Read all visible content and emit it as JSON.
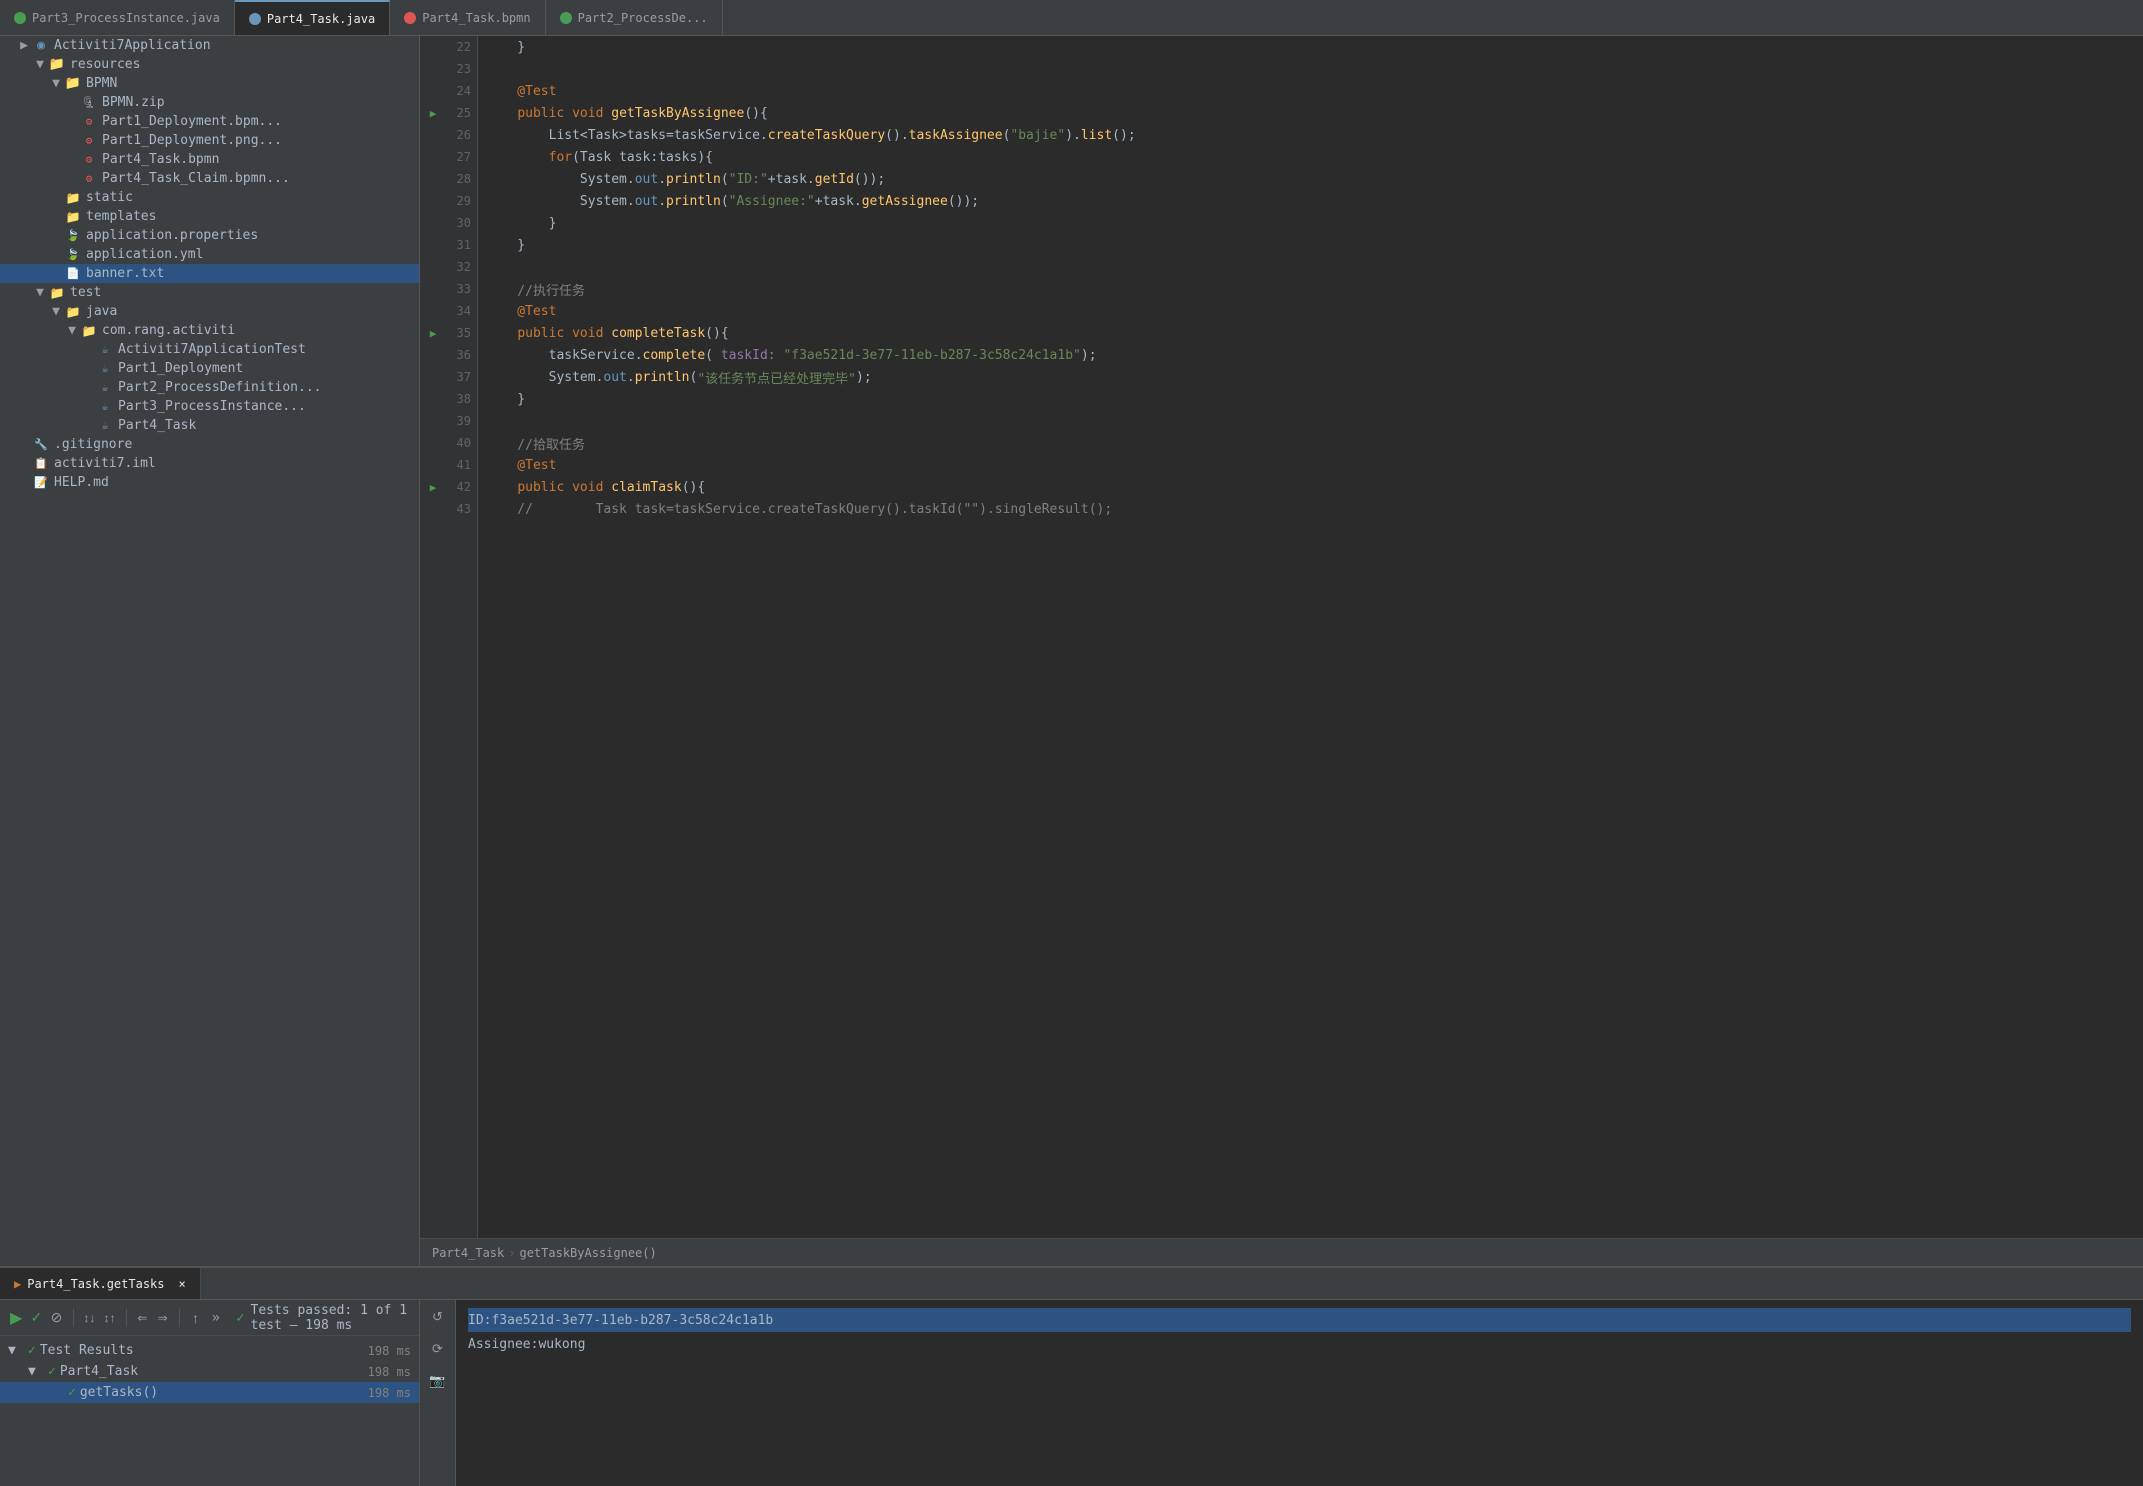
{
  "tabs": [
    {
      "label": "Part3_ProcessInstance.java",
      "status": "green",
      "active": false
    },
    {
      "label": "Part4_Task.java",
      "status": "blue",
      "active": true
    },
    {
      "label": "Part4_Task.bpmn",
      "status": "red",
      "active": false
    },
    {
      "label": "Part2_ProcessDe...",
      "status": "green",
      "active": false
    }
  ],
  "sidebar": {
    "tree": [
      {
        "indent": 0,
        "arrow": "▶",
        "icon": "app",
        "label": "Activiti7Application",
        "type": "app"
      },
      {
        "indent": 1,
        "arrow": "▼",
        "icon": "folder",
        "label": "resources",
        "type": "folder"
      },
      {
        "indent": 2,
        "arrow": "▼",
        "icon": "folder",
        "label": "BPMN",
        "type": "folder"
      },
      {
        "indent": 3,
        "arrow": "",
        "icon": "zip",
        "label": "BPMN.zip",
        "type": "zip"
      },
      {
        "indent": 3,
        "arrow": "",
        "icon": "bpmn",
        "label": "Part1_Deployment.bpm...",
        "type": "bpmn"
      },
      {
        "indent": 3,
        "arrow": "",
        "icon": "bpmn",
        "label": "Part1_Deployment.png...",
        "type": "bpmn"
      },
      {
        "indent": 3,
        "arrow": "",
        "icon": "bpmn",
        "label": "Part4_Task.bpmn",
        "type": "bpmn"
      },
      {
        "indent": 3,
        "arrow": "",
        "icon": "bpmn",
        "label": "Part4_Task_Claim.bpmn...",
        "type": "bpmn"
      },
      {
        "indent": 2,
        "arrow": "",
        "icon": "folder",
        "label": "static",
        "type": "folder"
      },
      {
        "indent": 2,
        "arrow": "",
        "icon": "folder",
        "label": "templates",
        "type": "folder"
      },
      {
        "indent": 2,
        "arrow": "",
        "icon": "spring",
        "label": "application.properties",
        "type": "spring"
      },
      {
        "indent": 2,
        "arrow": "",
        "icon": "spring",
        "label": "application.yml",
        "type": "spring"
      },
      {
        "indent": 2,
        "arrow": "",
        "icon": "txt",
        "label": "banner.txt",
        "type": "txt",
        "selected": true
      },
      {
        "indent": 1,
        "arrow": "▼",
        "icon": "folder",
        "label": "test",
        "type": "folder"
      },
      {
        "indent": 2,
        "arrow": "▼",
        "icon": "folder",
        "label": "java",
        "type": "folder"
      },
      {
        "indent": 3,
        "arrow": "▼",
        "icon": "folder",
        "label": "com.rang.activiti",
        "type": "folder"
      },
      {
        "indent": 4,
        "arrow": "",
        "icon": "java",
        "label": "Activiti7ApplicationTest",
        "type": "java"
      },
      {
        "indent": 4,
        "arrow": "",
        "icon": "java",
        "label": "Part1_Deployment",
        "type": "java"
      },
      {
        "indent": 4,
        "arrow": "",
        "icon": "java",
        "label": "Part2_ProcessDefinition...",
        "type": "java"
      },
      {
        "indent": 4,
        "arrow": "",
        "icon": "java",
        "label": "Part3_ProcessInstance...",
        "type": "java"
      },
      {
        "indent": 4,
        "arrow": "",
        "icon": "java",
        "label": "Part4_Task",
        "type": "java"
      },
      {
        "indent": 0,
        "arrow": "",
        "icon": "git",
        "label": ".gitignore",
        "type": "git"
      },
      {
        "indent": 0,
        "arrow": "",
        "icon": "iml",
        "label": "activiti7.iml",
        "type": "iml"
      },
      {
        "indent": 0,
        "arrow": "",
        "icon": "md",
        "label": "HELP.md",
        "type": "md"
      }
    ]
  },
  "code": {
    "lines": [
      {
        "num": 22,
        "gutter_icon": "",
        "content": "    }"
      },
      {
        "num": 23,
        "gutter_icon": "",
        "content": ""
      },
      {
        "num": 24,
        "gutter_icon": "",
        "content": "    @Test"
      },
      {
        "num": 25,
        "gutter_icon": "▶",
        "content": "    public void getTaskByAssignee(){"
      },
      {
        "num": 26,
        "gutter_icon": "",
        "content": "        List<Task>tasks=taskService.createTaskQuery().taskAssignee(\"bajie\").list();"
      },
      {
        "num": 27,
        "gutter_icon": "",
        "content": "        for(Task task:tasks){"
      },
      {
        "num": 28,
        "gutter_icon": "",
        "content": "            System.out.println(\"ID:\"+task.getId());"
      },
      {
        "num": 29,
        "gutter_icon": "",
        "content": "            System.out.println(\"Assignee:\"+task.getAssignee());"
      },
      {
        "num": 30,
        "gutter_icon": "",
        "content": "        }"
      },
      {
        "num": 31,
        "gutter_icon": "",
        "content": "    }"
      },
      {
        "num": 32,
        "gutter_icon": "",
        "content": ""
      },
      {
        "num": 33,
        "gutter_icon": "",
        "content": "    //执行任务"
      },
      {
        "num": 34,
        "gutter_icon": "",
        "content": "    @Test"
      },
      {
        "num": 35,
        "gutter_icon": "▶",
        "content": "    public void completeTask(){"
      },
      {
        "num": 36,
        "gutter_icon": "",
        "content": "        taskService.complete( taskId: \"f3ae521d-3e77-11eb-b287-3c58c24c1a1b\");"
      },
      {
        "num": 37,
        "gutter_icon": "",
        "content": "        System.out.println(\"该任务节点已经处理完毕\");"
      },
      {
        "num": 38,
        "gutter_icon": "",
        "content": "    }"
      },
      {
        "num": 39,
        "gutter_icon": "",
        "content": ""
      },
      {
        "num": 40,
        "gutter_icon": "",
        "content": "    //拾取任务"
      },
      {
        "num": 41,
        "gutter_icon": "",
        "content": "    @Test"
      },
      {
        "num": 42,
        "gutter_icon": "▶",
        "content": "    public void claimTask(){"
      },
      {
        "num": 43,
        "gutter_icon": "",
        "content": "    //        Task task=taskService.createTaskQuery().taskId(\"\").singleResult();"
      }
    ]
  },
  "breadcrumb": {
    "file": "Part4_Task",
    "method": "getTaskByAssignee()"
  },
  "run_panel": {
    "tab_label": "Part4_Task.getTasks",
    "close": "×",
    "toolbar": {
      "run": "▶",
      "check": "✓",
      "stop": "⊘",
      "sort_az": "↕",
      "sort_za": "↕",
      "collapse": "⇐",
      "expand": "⇒",
      "up": "↑",
      "more": "»"
    },
    "status_text": "Tests passed: 1 of 1 test – 198 ms",
    "tree": [
      {
        "indent": 0,
        "arrow": "▼",
        "check": "✓",
        "label": "Test Results",
        "time": "198 ms"
      },
      {
        "indent": 1,
        "arrow": "▼",
        "check": "✓",
        "label": "Part4_Task",
        "time": "198 ms"
      },
      {
        "indent": 2,
        "arrow": "",
        "check": "✓",
        "label": "getTasks()",
        "time": "198 ms",
        "selected": true
      }
    ],
    "output": [
      {
        "text": "ID:f3ae521d-3e77-11eb-b287-3c58c24c1a1b",
        "highlight": true
      },
      {
        "text": "Assignee:wukong",
        "highlight": false
      }
    ]
  },
  "colors": {
    "accent_blue": "#6897bb",
    "accent_green": "#499c54",
    "accent_red": "#e05555",
    "bg_dark": "#2b2b2b",
    "bg_sidebar": "#3c3f41",
    "bg_selected": "#2d5382"
  }
}
